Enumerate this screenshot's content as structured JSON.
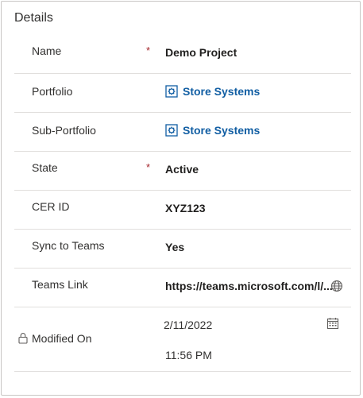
{
  "section": {
    "title": "Details"
  },
  "fields": {
    "name": {
      "label": "Name",
      "required_mark": "*",
      "value": "Demo Project"
    },
    "portfolio": {
      "label": "Portfolio",
      "value": "Store Systems",
      "icon": "entity-record-icon"
    },
    "sub_portfolio": {
      "label": "Sub-Portfolio",
      "value": "Store Systems",
      "icon": "entity-record-icon"
    },
    "state": {
      "label": "State",
      "required_mark": "*",
      "value": "Active"
    },
    "cer_id": {
      "label": "CER ID",
      "value": "XYZ123"
    },
    "sync_to_teams": {
      "label": "Sync to Teams",
      "value": "Yes"
    },
    "teams_link": {
      "label": "Teams Link",
      "value": "https://teams.microsoft.com/l/...",
      "icon": "globe-icon"
    },
    "modified_on": {
      "label": "Modified On",
      "date": "2/11/2022",
      "time": "11:56 PM",
      "icons": [
        "lock-icon",
        "calendar-icon"
      ]
    }
  },
  "colors": {
    "link": "#115ea3",
    "required": "#a4262c",
    "divider": "#e1dfdd",
    "border": "#c8c6c4"
  }
}
